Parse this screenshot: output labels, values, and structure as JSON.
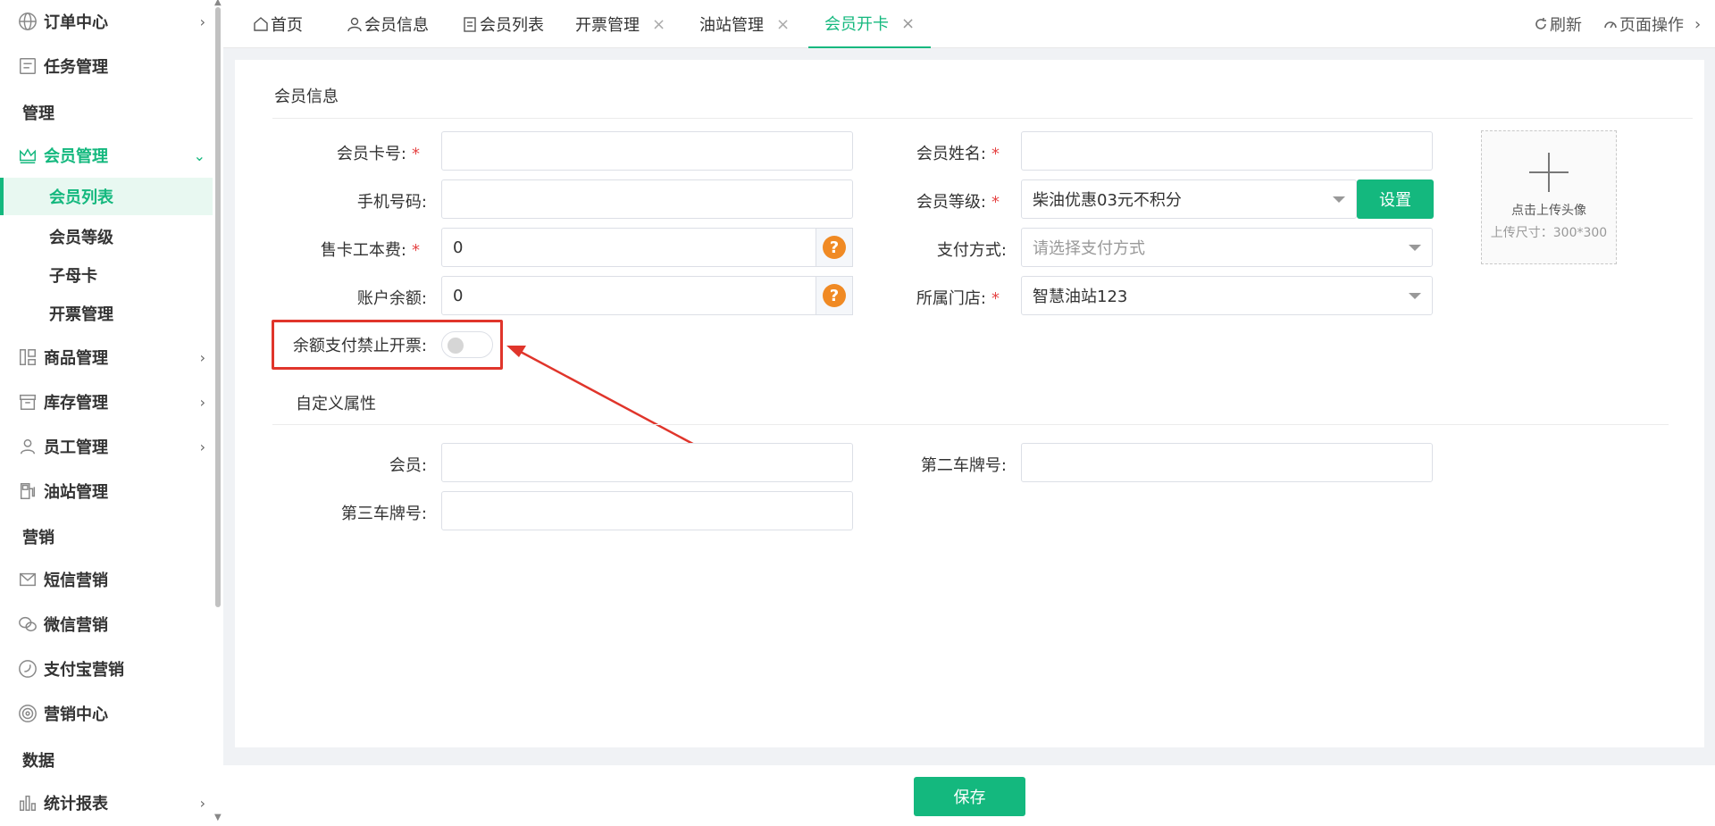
{
  "sidebar": {
    "items": [
      {
        "label": "订单中心",
        "icon": "globe-icon",
        "chevron": true
      },
      {
        "label": "任务管理",
        "icon": "task-icon",
        "chevron": false
      },
      {
        "section": "管理"
      },
      {
        "label": "会员管理",
        "icon": "crown-icon",
        "chevron": true,
        "expanded": true
      },
      {
        "label": "商品管理",
        "icon": "goods-icon",
        "chevron": true
      },
      {
        "label": "库存管理",
        "icon": "stock-icon",
        "chevron": true
      },
      {
        "label": "员工管理",
        "icon": "user-icon",
        "chevron": true
      },
      {
        "label": "油站管理",
        "icon": "fuel-station-icon",
        "chevron": false
      },
      {
        "section": "营销"
      },
      {
        "label": "短信营销",
        "icon": "mail-icon",
        "chevron": false
      },
      {
        "label": "微信营销",
        "icon": "wechat-icon",
        "chevron": false
      },
      {
        "label": "支付宝营销",
        "icon": "alipay-icon",
        "chevron": false
      },
      {
        "label": "营销中心",
        "icon": "target-icon",
        "chevron": false
      },
      {
        "section": "数据"
      },
      {
        "label": "统计报表",
        "icon": "chart-icon",
        "chevron": true
      }
    ],
    "labels": {
      "order_center": "订单中心",
      "task_mgmt": "任务管理",
      "section_manage": "管理",
      "member_mgmt": "会员管理",
      "member_list": "会员列表",
      "member_level": "会员等级",
      "sub_card": "子母卡",
      "invoice_mgmt": "开票管理",
      "goods_mgmt": "商品管理",
      "stock_mgmt": "库存管理",
      "staff_mgmt": "员工管理",
      "station_mgmt": "油站管理",
      "section_marketing": "营销",
      "sms_marketing": "短信营销",
      "wechat_marketing": "微信营销",
      "alipay_marketing": "支付宝营销",
      "marketing_center": "营销中心",
      "section_data": "数据",
      "stats_report": "统计报表"
    }
  },
  "tabs": {
    "home": "首页",
    "member_info": "会员信息",
    "member_list": "会员列表",
    "invoice": "开票管理",
    "station": "油站管理",
    "open_card": "会员开卡",
    "refresh": "刷新",
    "page_ops": "页面操作"
  },
  "form": {
    "section_title": "会员信息",
    "card_no_label": "会员卡号:",
    "name_label": "会员姓名:",
    "phone_label": "手机号码:",
    "level_label": "会员等级:",
    "level_value": "柴油优惠03元不积分",
    "set_button": "设置",
    "fee_label": "售卡工本费:",
    "fee_value": "0",
    "pay_label": "支付方式:",
    "pay_placeholder": "请选择支付方式",
    "balance_label": "账户余额:",
    "balance_value": "0",
    "store_label": "所属门店:",
    "store_value": "智慧油站123",
    "no_invoice_label": "余额支付禁止开票:",
    "no_invoice_on": false,
    "required_mark": "*",
    "help_mark": "?",
    "upload_text": "点击上传头像",
    "upload_size": "上传尺寸：300*300",
    "custom_title": "自定义属性",
    "custom_member_label": "会员:",
    "second_plate_label": "第二车牌号:",
    "third_plate_label": "第三车牌号:"
  },
  "footer": {
    "save": "保存"
  },
  "colors": {
    "accent": "#14b87e",
    "required": "#e54545",
    "help": "#f08a24",
    "annotation": "#e0352b"
  }
}
